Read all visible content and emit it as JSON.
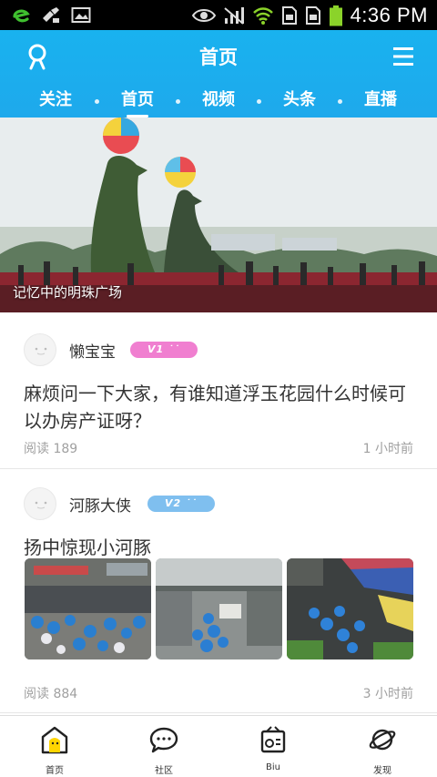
{
  "status_bar": {
    "time": "4:36 PM"
  },
  "header": {
    "title": "首页",
    "tabs": [
      {
        "label": "关注"
      },
      {
        "label": "首页"
      },
      {
        "label": "视频"
      },
      {
        "label": "头条"
      },
      {
        "label": "直播"
      }
    ],
    "active_tab": "首页"
  },
  "banner": {
    "caption": "记忆中的明珠广场"
  },
  "posts": [
    {
      "author": "懒宝宝",
      "badge": "V1",
      "badge_color": "#f07fd0",
      "title": "麻烦问一下大家，有谁知道浮玉花园什么时候可以办房产证呀？",
      "reads": "阅读 189",
      "time": "1 小时前"
    },
    {
      "author": "河豚大侠",
      "badge": "V2",
      "badge_color": "#7fbfef",
      "title": "扬中惊现小河豚",
      "reads": "阅读 884",
      "time": "3 小时前"
    }
  ],
  "bottom_nav": [
    {
      "label": "首页",
      "icon": "home-icon"
    },
    {
      "label": "社区",
      "icon": "chat-bubble-icon"
    },
    {
      "label": "Biu",
      "icon": "radio-icon"
    },
    {
      "label": "发现",
      "icon": "planet-icon"
    }
  ],
  "colors": {
    "header": "#1ea9ec",
    "accent": "#1ea9ec",
    "meta_text": "#a0a0a0"
  }
}
